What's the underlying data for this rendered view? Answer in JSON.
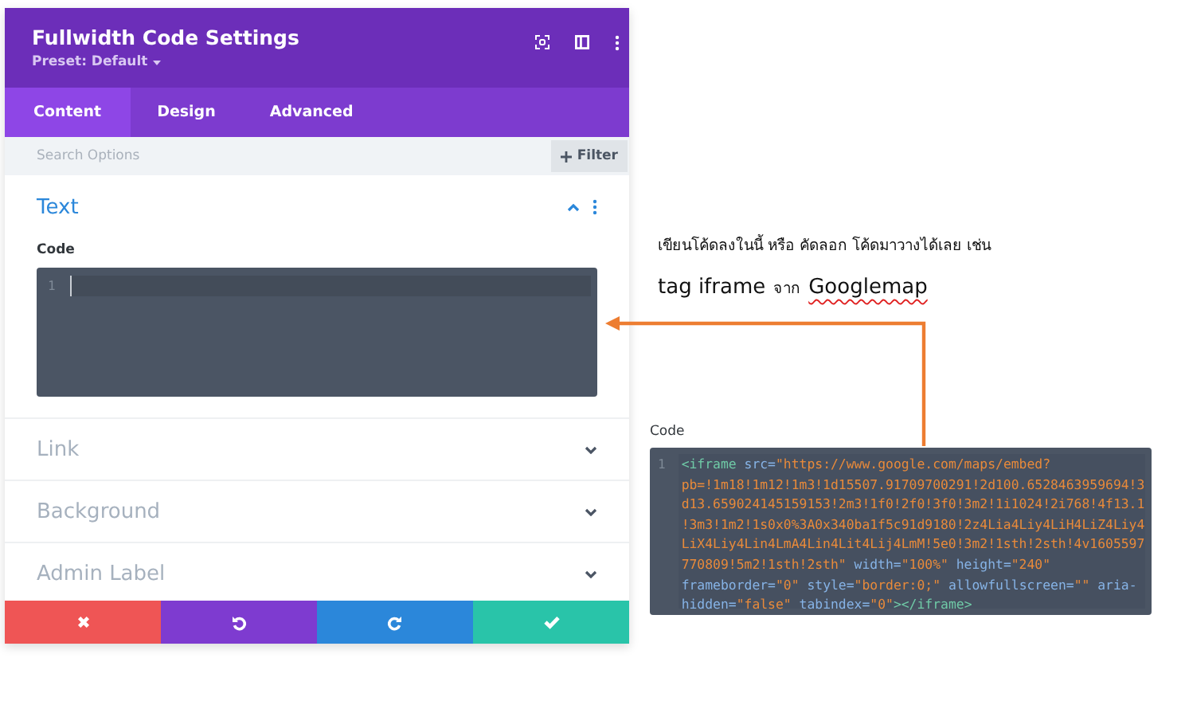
{
  "panel": {
    "title": "Fullwidth Code Settings",
    "preset": "Preset: Default"
  },
  "tabs": [
    {
      "label": "Content",
      "selected": true
    },
    {
      "label": "Design",
      "selected": false
    },
    {
      "label": "Advanced",
      "selected": false
    }
  ],
  "search": {
    "placeholder": "Search Options",
    "filter_label": "Filter"
  },
  "sections": [
    {
      "title": "Text",
      "expanded": true,
      "field_label": "Code",
      "line_number": "1"
    },
    {
      "title": "Link",
      "expanded": false
    },
    {
      "title": "Background",
      "expanded": false
    },
    {
      "title": "Admin Label",
      "expanded": false
    }
  ],
  "actions": [
    {
      "kind": "discard"
    },
    {
      "kind": "undo"
    },
    {
      "kind": "redo"
    },
    {
      "kind": "save"
    }
  ],
  "annotation": {
    "line_1": "เขียนโค้ดลงในนี้ หรือ คัดลอก โค้ดมาวางได้เลย เช่น",
    "line_2": [
      {
        "text": "tag iframe",
        "kind": "large"
      },
      {
        "text": "จาก",
        "kind": "small"
      },
      {
        "text": "Googlemap",
        "kind": "misspelled"
      }
    ]
  },
  "example": {
    "label": "Code",
    "line_number": "1",
    "tokens": [
      {
        "kind": "tag",
        "text": "<iframe"
      },
      {
        "kind": "attr",
        "text": " src="
      },
      {
        "kind": "value",
        "text": "\"https://www.google.com/maps/embed?pb=!1m18!1m12!1m3!1d15507.91709700291!2d100.6528463959694!3d13.659024145159153!2m3!1f0!2f0!3f0!3m2!1i1024!2i768!4f13.1!3m3!1m2!1s0x0%3A0x340ba1f5c91d9180!2z4Lia4Liy4LiH4LiZ4Liy4LiX4Liy4Lin4LmA4Lin4Lit4Lij4LmM!5e0!3m2!1sth!2sth!4v1605597770809!5m2!1sth!2sth\""
      },
      {
        "kind": "attr",
        "text": " width="
      },
      {
        "kind": "value",
        "text": "\"100%\""
      },
      {
        "kind": "attr",
        "text": " height="
      },
      {
        "kind": "value",
        "text": "\"240\""
      },
      {
        "kind": "attr",
        "text": " frameborder="
      },
      {
        "kind": "value",
        "text": "\"0\""
      },
      {
        "kind": "attr",
        "text": " style="
      },
      {
        "kind": "value",
        "text": "\"border:0;\""
      },
      {
        "kind": "attr",
        "text": " allowfullscreen="
      },
      {
        "kind": "value",
        "text": "\"\""
      },
      {
        "kind": "attr",
        "text": " aria-hidden="
      },
      {
        "kind": "value",
        "text": "\"false\""
      },
      {
        "kind": "attr",
        "text": " tabindex="
      },
      {
        "kind": "value",
        "text": "\"0\""
      },
      {
        "kind": "tag",
        "text": "></iframe>"
      }
    ]
  }
}
